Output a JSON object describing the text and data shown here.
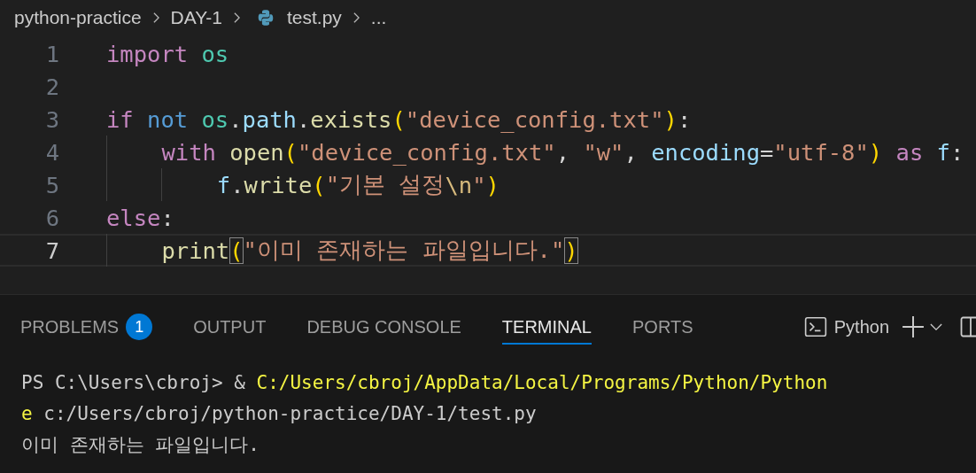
{
  "breadcrumb": [
    {
      "text": "python-practice",
      "kind": "folder"
    },
    {
      "text": "DAY-1",
      "kind": "folder"
    },
    {
      "text": "test.py",
      "kind": "file"
    },
    {
      "text": "...",
      "kind": "more"
    }
  ],
  "editor": {
    "lines": [
      {
        "number": "1",
        "selected": false,
        "tokens": [
          {
            "kind": "control",
            "text": "import "
          },
          {
            "kind": "module",
            "text": "os"
          }
        ]
      },
      {
        "number": "2",
        "selected": false
      },
      {
        "number": "3",
        "selected": false,
        "tokens": [
          {
            "kind": "control",
            "text": "if "
          },
          {
            "kind": "keyword",
            "text": "not "
          },
          {
            "kind": "module",
            "text": "os"
          },
          {
            "kind": "plain",
            "text": "."
          },
          {
            "kind": "variable",
            "text": "path"
          },
          {
            "kind": "plain",
            "text": "."
          },
          {
            "kind": "function",
            "text": "exists"
          },
          {
            "kind": "bracket",
            "text": "("
          },
          {
            "kind": "string",
            "text": "\"device_config.txt\""
          },
          {
            "kind": "bracket",
            "text": ")"
          },
          {
            "kind": "plain",
            "text": ":"
          }
        ]
      },
      {
        "number": "4",
        "selected": false,
        "tokens": [
          {
            "kind": "indent"
          },
          {
            "kind": "control",
            "text": "with "
          },
          {
            "kind": "function",
            "text": "open"
          },
          {
            "kind": "bracket",
            "text": "("
          },
          {
            "kind": "string",
            "text": "\"device_config.txt\""
          },
          {
            "kind": "plain",
            "text": ", "
          },
          {
            "kind": "string",
            "text": "\"w\""
          },
          {
            "kind": "plain",
            "text": ", "
          },
          {
            "kind": "variable",
            "text": "encoding"
          },
          {
            "kind": "plain",
            "text": "="
          },
          {
            "kind": "string",
            "text": "\"utf-8\""
          },
          {
            "kind": "bracket",
            "text": ") "
          },
          {
            "kind": "control",
            "text": "as "
          },
          {
            "kind": "variable",
            "text": "f"
          },
          {
            "kind": "plain",
            "text": ":"
          }
        ]
      },
      {
        "number": "5",
        "selected": false,
        "tokens": [
          {
            "kind": "indent"
          },
          {
            "kind": "indent"
          },
          {
            "kind": "variable",
            "text": "f"
          },
          {
            "kind": "plain",
            "text": "."
          },
          {
            "kind": "function",
            "text": "write"
          },
          {
            "kind": "bracket",
            "text": "("
          },
          {
            "kind": "string",
            "text": "\"기본 설정"
          },
          {
            "kind": "escape",
            "text": "\\n"
          },
          {
            "kind": "string",
            "text": "\""
          },
          {
            "kind": "bracket",
            "text": ")"
          }
        ]
      },
      {
        "number": "6",
        "selected": false,
        "tokens": [
          {
            "kind": "control",
            "text": "else"
          },
          {
            "kind": "plain",
            "text": ":"
          }
        ]
      },
      {
        "number": "7",
        "selected": true,
        "tokens": [
          {
            "kind": "indent"
          },
          {
            "kind": "function",
            "text": "print"
          },
          {
            "kind": "bracket-match",
            "text": "("
          },
          {
            "kind": "string",
            "text": "\"이미 존재하는 파일입니다.\""
          },
          {
            "kind": "bracket-match",
            "text": ")"
          }
        ]
      }
    ]
  },
  "panel": {
    "tabs": [
      {
        "label": "PROBLEMS",
        "badge": "1",
        "selected": false
      },
      {
        "label": "OUTPUT",
        "selected": false
      },
      {
        "label": "DEBUG CONSOLE",
        "selected": false
      },
      {
        "label": "TERMINAL",
        "selected": true
      },
      {
        "label": "PORTS",
        "selected": false
      }
    ],
    "terminal_name": "Python"
  },
  "terminal": {
    "lines": [
      {
        "segments": [
          {
            "kind": "plain",
            "text": "PS C:\\Users\\cbroj> & "
          },
          {
            "kind": "path",
            "text": "C:/Users/cbroj/AppData/Local/Programs/Python/Python"
          }
        ]
      },
      {
        "segments": [
          {
            "kind": "path",
            "text": "e"
          },
          {
            "kind": "plain",
            "text": " c:/Users/cbroj/python-practice/DAY-1/test.py"
          }
        ]
      },
      {
        "segments": [
          {
            "kind": "plain",
            "text": "이미 존재하는 파일입니다."
          }
        ]
      }
    ]
  }
}
